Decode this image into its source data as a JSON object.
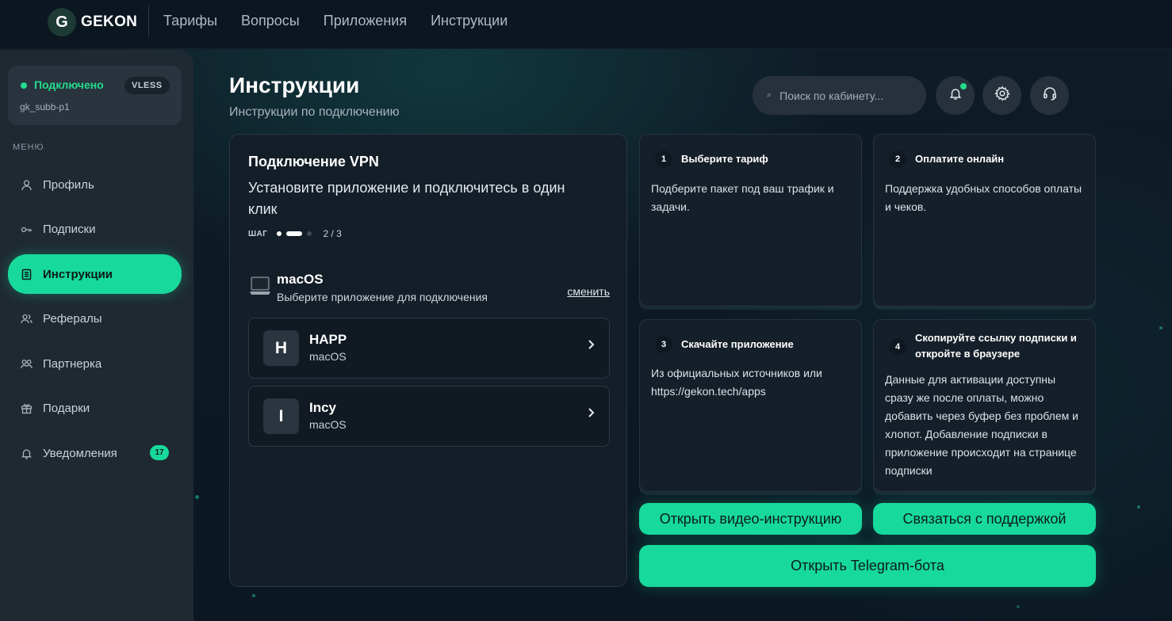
{
  "brand": {
    "logo_letter": "G",
    "name": "GEKON"
  },
  "topnav": [
    "Тарифы",
    "Вопросы",
    "Приложения",
    "Инструкции"
  ],
  "status": {
    "label": "Подключено",
    "protocol": "VLESS",
    "user": "gk_subb-p1"
  },
  "menu": {
    "heading": "МЕНЮ",
    "items": [
      {
        "label": "Профиль",
        "icon": "user-icon"
      },
      {
        "label": "Подписки",
        "icon": "key-icon"
      },
      {
        "label": "Инструкции",
        "icon": "document-icon",
        "active": true
      },
      {
        "label": "Рефералы",
        "icon": "users-icon"
      },
      {
        "label": "Партнерка",
        "icon": "partners-icon"
      },
      {
        "label": "Подарки",
        "icon": "gift-icon"
      },
      {
        "label": "Уведомления",
        "icon": "bell-icon",
        "badge": "17"
      }
    ]
  },
  "header": {
    "title": "Инструкции",
    "subtitle": "Инструкции по подключению",
    "search_placeholder": "Поиск по кабинету..."
  },
  "vpn": {
    "title": "Подключение VPN",
    "description": "Установите приложение и подключитесь в один клик",
    "step_word": "ШАГ",
    "step_count": "2 / 3",
    "os_name": "macOS",
    "os_hint": "Выберите приложение для подключения",
    "change_label": "сменить",
    "apps": [
      {
        "letter": "H",
        "name": "HAPP",
        "os": "macOS"
      },
      {
        "letter": "I",
        "name": "Incy",
        "os": "macOS"
      }
    ]
  },
  "steps": [
    {
      "num": "1",
      "title": "Выберите тариф",
      "text": "Подберите пакет под ваш трафик и задачи."
    },
    {
      "num": "2",
      "title": "Оплатите онлайн",
      "text": "Поддержка удобных способов оплаты и чеков."
    },
    {
      "num": "3",
      "title": "Скачайте приложение",
      "text": "Из официальных источников или https://gekon.tech/apps"
    },
    {
      "num": "4",
      "title": "Скопируйте ссылку подписки и откройте в браузере",
      "text": "Данные для активации доступны сразу же после оплаты, можно добавить через буфер без проблем и хлопот. Добавление подписки в приложение происходит на странице подписки"
    }
  ],
  "buttons": {
    "video": "Открыть видео-инструкцию",
    "support": "Связаться с поддержкой",
    "telegram": "Открыть Telegram-бота"
  },
  "colors": {
    "accent": "#17d99c",
    "status": "#22dd8e",
    "background": "#0d1a24",
    "sidebar": "#1f2932"
  }
}
